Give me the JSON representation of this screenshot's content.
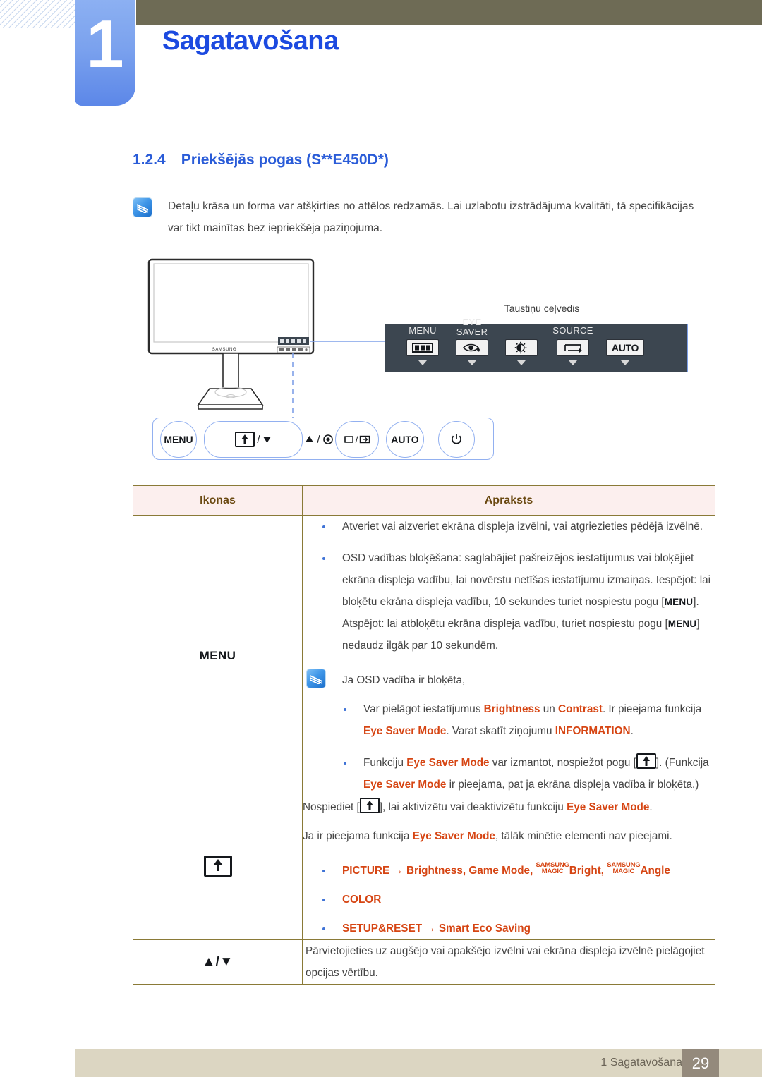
{
  "header": {
    "chapter_number": "1",
    "chapter_title": "Sagatavošana"
  },
  "section": {
    "number": "1.2.4",
    "title": "Priekšējās pogas (S**E450D*)"
  },
  "top_note": {
    "icon": "note-pencil-icon",
    "text": "Detaļu krāsa un forma var atšķirties no attēlos redzamās. Lai uzlabotu izstrādājuma kvalitāti, tā specifikācijas var tikt mainītas bez iepriekšēja paziņojuma."
  },
  "figure": {
    "brand_label": "SAMSUNG",
    "key_guide_label": "Taustiņu ceļvedis",
    "key_guide_buttons": [
      {
        "caption_line1": "",
        "caption_line2": "MENU",
        "icon": "menu-grid-icon"
      },
      {
        "caption_line1": "EYE",
        "caption_line2": "SAVER",
        "icon": "eye-saver-icon"
      },
      {
        "caption_line1": "",
        "caption_line2": "",
        "icon": "brightness-icon"
      },
      {
        "caption_line1": "",
        "caption_line2": "SOURCE",
        "icon": "source-loop-icon"
      },
      {
        "caption_line1": "",
        "caption_line2": "",
        "icon": "auto-text-icon",
        "text": "AUTO"
      }
    ],
    "front_buttons": [
      {
        "label": "MENU",
        "icon": "menu-button"
      },
      {
        "label": "/",
        "icon": "eye-saver-down-button"
      },
      {
        "label": "/",
        "icon": "up-enter-button"
      },
      {
        "label": "/",
        "icon": "source-return-button"
      },
      {
        "label": "AUTO",
        "icon": "auto-button"
      },
      {
        "label": "",
        "icon": "power-icon"
      }
    ]
  },
  "table": {
    "headers": [
      "Ikonas",
      "Apraksts"
    ],
    "rows": [
      {
        "icon_label": "MENU",
        "icon_name": "menu-text-icon",
        "bullets": [
          "Atveriet vai aizveriet ekrāna displeja izvēlni, vai atgriezieties pēdējā izvēlnē.",
          "OSD vadības bloķēšana: saglabājiet pašreizējos iestatījumus vai bloķējiet ekrāna displeja vadību, lai novērstu netīšas iestatījumu izmaiņas. Iespējot: lai bloķētu ekrāna displeja vadību, 10 sekundes turiet nospiestu pogu [MENU]. Atspējot: lai atbloķētu ekrāna displeja vadību, turiet nospiestu pogu [MENU] nedaudz ilgāk par 10 sekundēm."
        ],
        "inner_note": {
          "heading": "Ja OSD vadība ir bloķēta,",
          "bullets": [
            "Var pielāgot iestatījumus Brightness un Contrast. Ir pieejama funkcija Eye Saver Mode. Varat skatīt ziņojumu INFORMATION.",
            "Funkciju Eye Saver Mode var izmantot, nospiežot pogu [ ]. (Funkcija Eye Saver Mode ir pieejama, pat ja ekrāna displeja vadība ir bloķēta.)"
          ]
        }
      },
      {
        "icon_label": "",
        "icon_name": "eye-saver-mode-icon",
        "paragraphs": [
          "Nospiediet [ ], lai aktivizētu vai deaktivizētu funkciju Eye Saver Mode.",
          "Ja ir pieejama funkcija Eye Saver Mode, tālāk minētie elementi nav pieejami."
        ],
        "feature_bullets": [
          "PICTURE → Brightness, Game Mode, SAMSUNG MAGIC Bright, SAMSUNG MAGIC Angle",
          "COLOR",
          "SETUP&RESET → Smart Eco Saving"
        ]
      },
      {
        "icon_label": "▲/▼",
        "icon_name": "up-down-arrows-icon",
        "paragraphs": [
          "Pārvietojieties uz augšējo vai apakšējo izvēlni vai ekrāna displeja izvēlnē pielāgojiet opcijas vērtību."
        ]
      }
    ]
  },
  "inline_terms": {
    "brightness": "Brightness",
    "contrast": "Contrast",
    "eye_saver_mode": "Eye Saver Mode",
    "information": "INFORMATION",
    "picture": "PICTURE",
    "game_mode": "Game Mode",
    "magic_bright": "Bright",
    "magic_angle": "Angle",
    "samsung": "SAMSUNG",
    "magic": "MAGIC",
    "color": "COLOR",
    "setup_reset": "SETUP&RESET",
    "smart_eco_saving": "Smart Eco Saving",
    "menu_key": "MENU",
    "arrow": "→"
  },
  "footer": {
    "text": "1 Sagatavošana",
    "page": "29"
  },
  "colors": {
    "chapter_blue": "#5c87e8",
    "title_blue": "#1c4ae0",
    "heading_blue": "#2a5cd8",
    "olive": "#6e6b55",
    "table_border": "#8a7a37",
    "table_inner": "#e8a18d",
    "table_head_bg": "#fcefee",
    "table_head_fg": "#6b4a12",
    "orange": "#d64513",
    "footer_bg": "#dcd6c2",
    "footer_page_bg": "#948a7c",
    "keyguide_bg": "#3c4650"
  }
}
